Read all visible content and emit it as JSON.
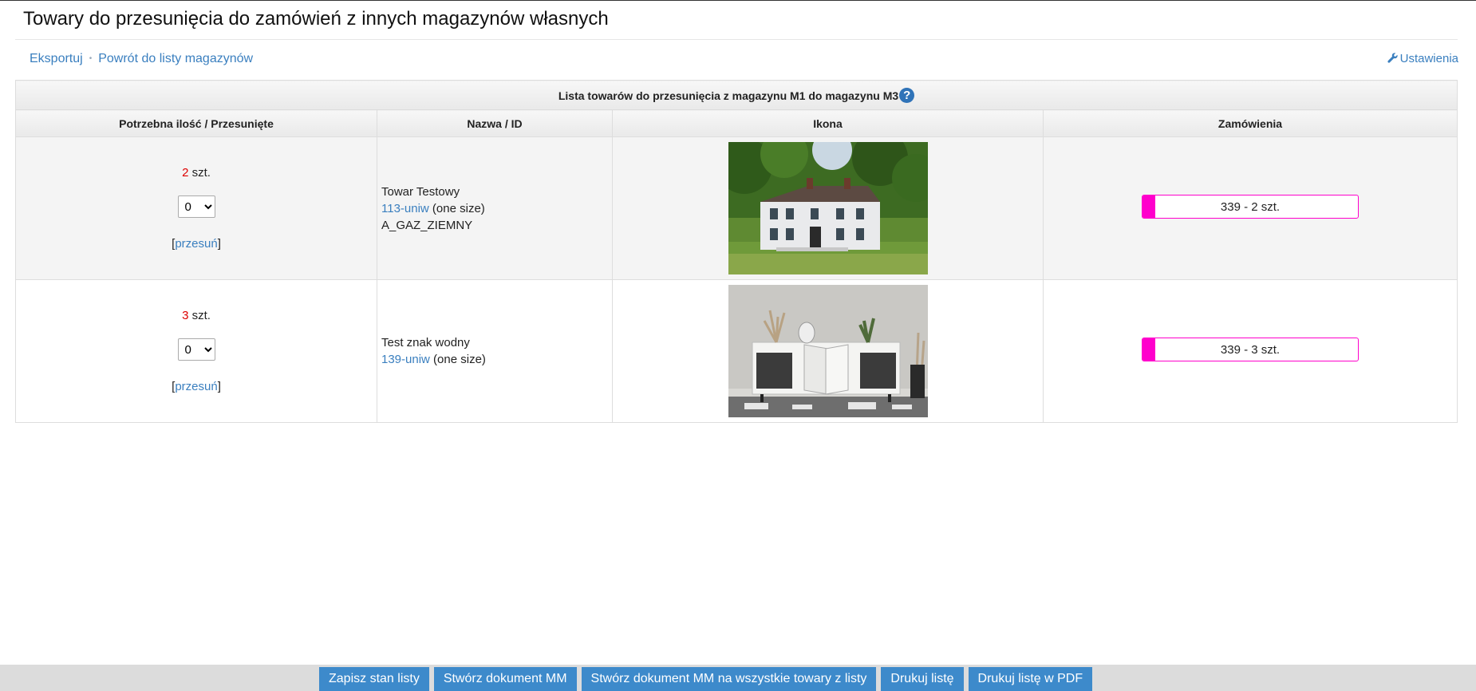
{
  "page": {
    "title": "Towary do przesunięcia do zamówień z innych magazynów własnych"
  },
  "toolbar": {
    "export_label": "Eksportuj",
    "back_label": "Powrót do listy magazynów",
    "settings_label": "Ustawienia",
    "separator": "•"
  },
  "table": {
    "caption": "Lista towarów do przesunięcia z magazynu M1 do magazynu M3",
    "help_icon_glyph": "?",
    "headers": [
      "Potrzebna ilość / Przesunięte",
      "Nazwa / ID",
      "Ikona",
      "Zamówienia"
    ],
    "rows": [
      {
        "qty_needed": "2",
        "qty_unit": " szt.",
        "moved_select_value": "0",
        "move_link_open": "[",
        "move_link": "przesuń",
        "move_link_close": "]",
        "name": "Towar Testowy",
        "id_link": "113-uniw",
        "size": " (one size)",
        "extra": "A_GAZ_ZIEMNY",
        "image": "house-photo",
        "order_label": "339 - 2 szt.",
        "order_progress": 0.06
      },
      {
        "qty_needed": "3",
        "qty_unit": " szt.",
        "moved_select_value": "0",
        "move_link_open": "[",
        "move_link": "przesuń",
        "move_link_close": "]",
        "name": "Test znak wodny",
        "id_link": "139-uniw",
        "size": " (one size)",
        "extra": "",
        "image": "sideboard-photo",
        "order_label": "339 - 3 szt.",
        "order_progress": 0.06
      }
    ]
  },
  "footer": {
    "buttons": [
      "Zapisz stan listy",
      "Stwórz dokument MM",
      "Stwórz dokument MM na wszystkie towary z listy",
      "Drukuj listę",
      "Drukuj listę w PDF"
    ]
  },
  "colors": {
    "link": "#3a7fbf",
    "qty_red": "#dd0000",
    "order_accent": "#ff00cc",
    "button_bg": "#3d8acb",
    "footer_bg": "#dcdcdc"
  }
}
